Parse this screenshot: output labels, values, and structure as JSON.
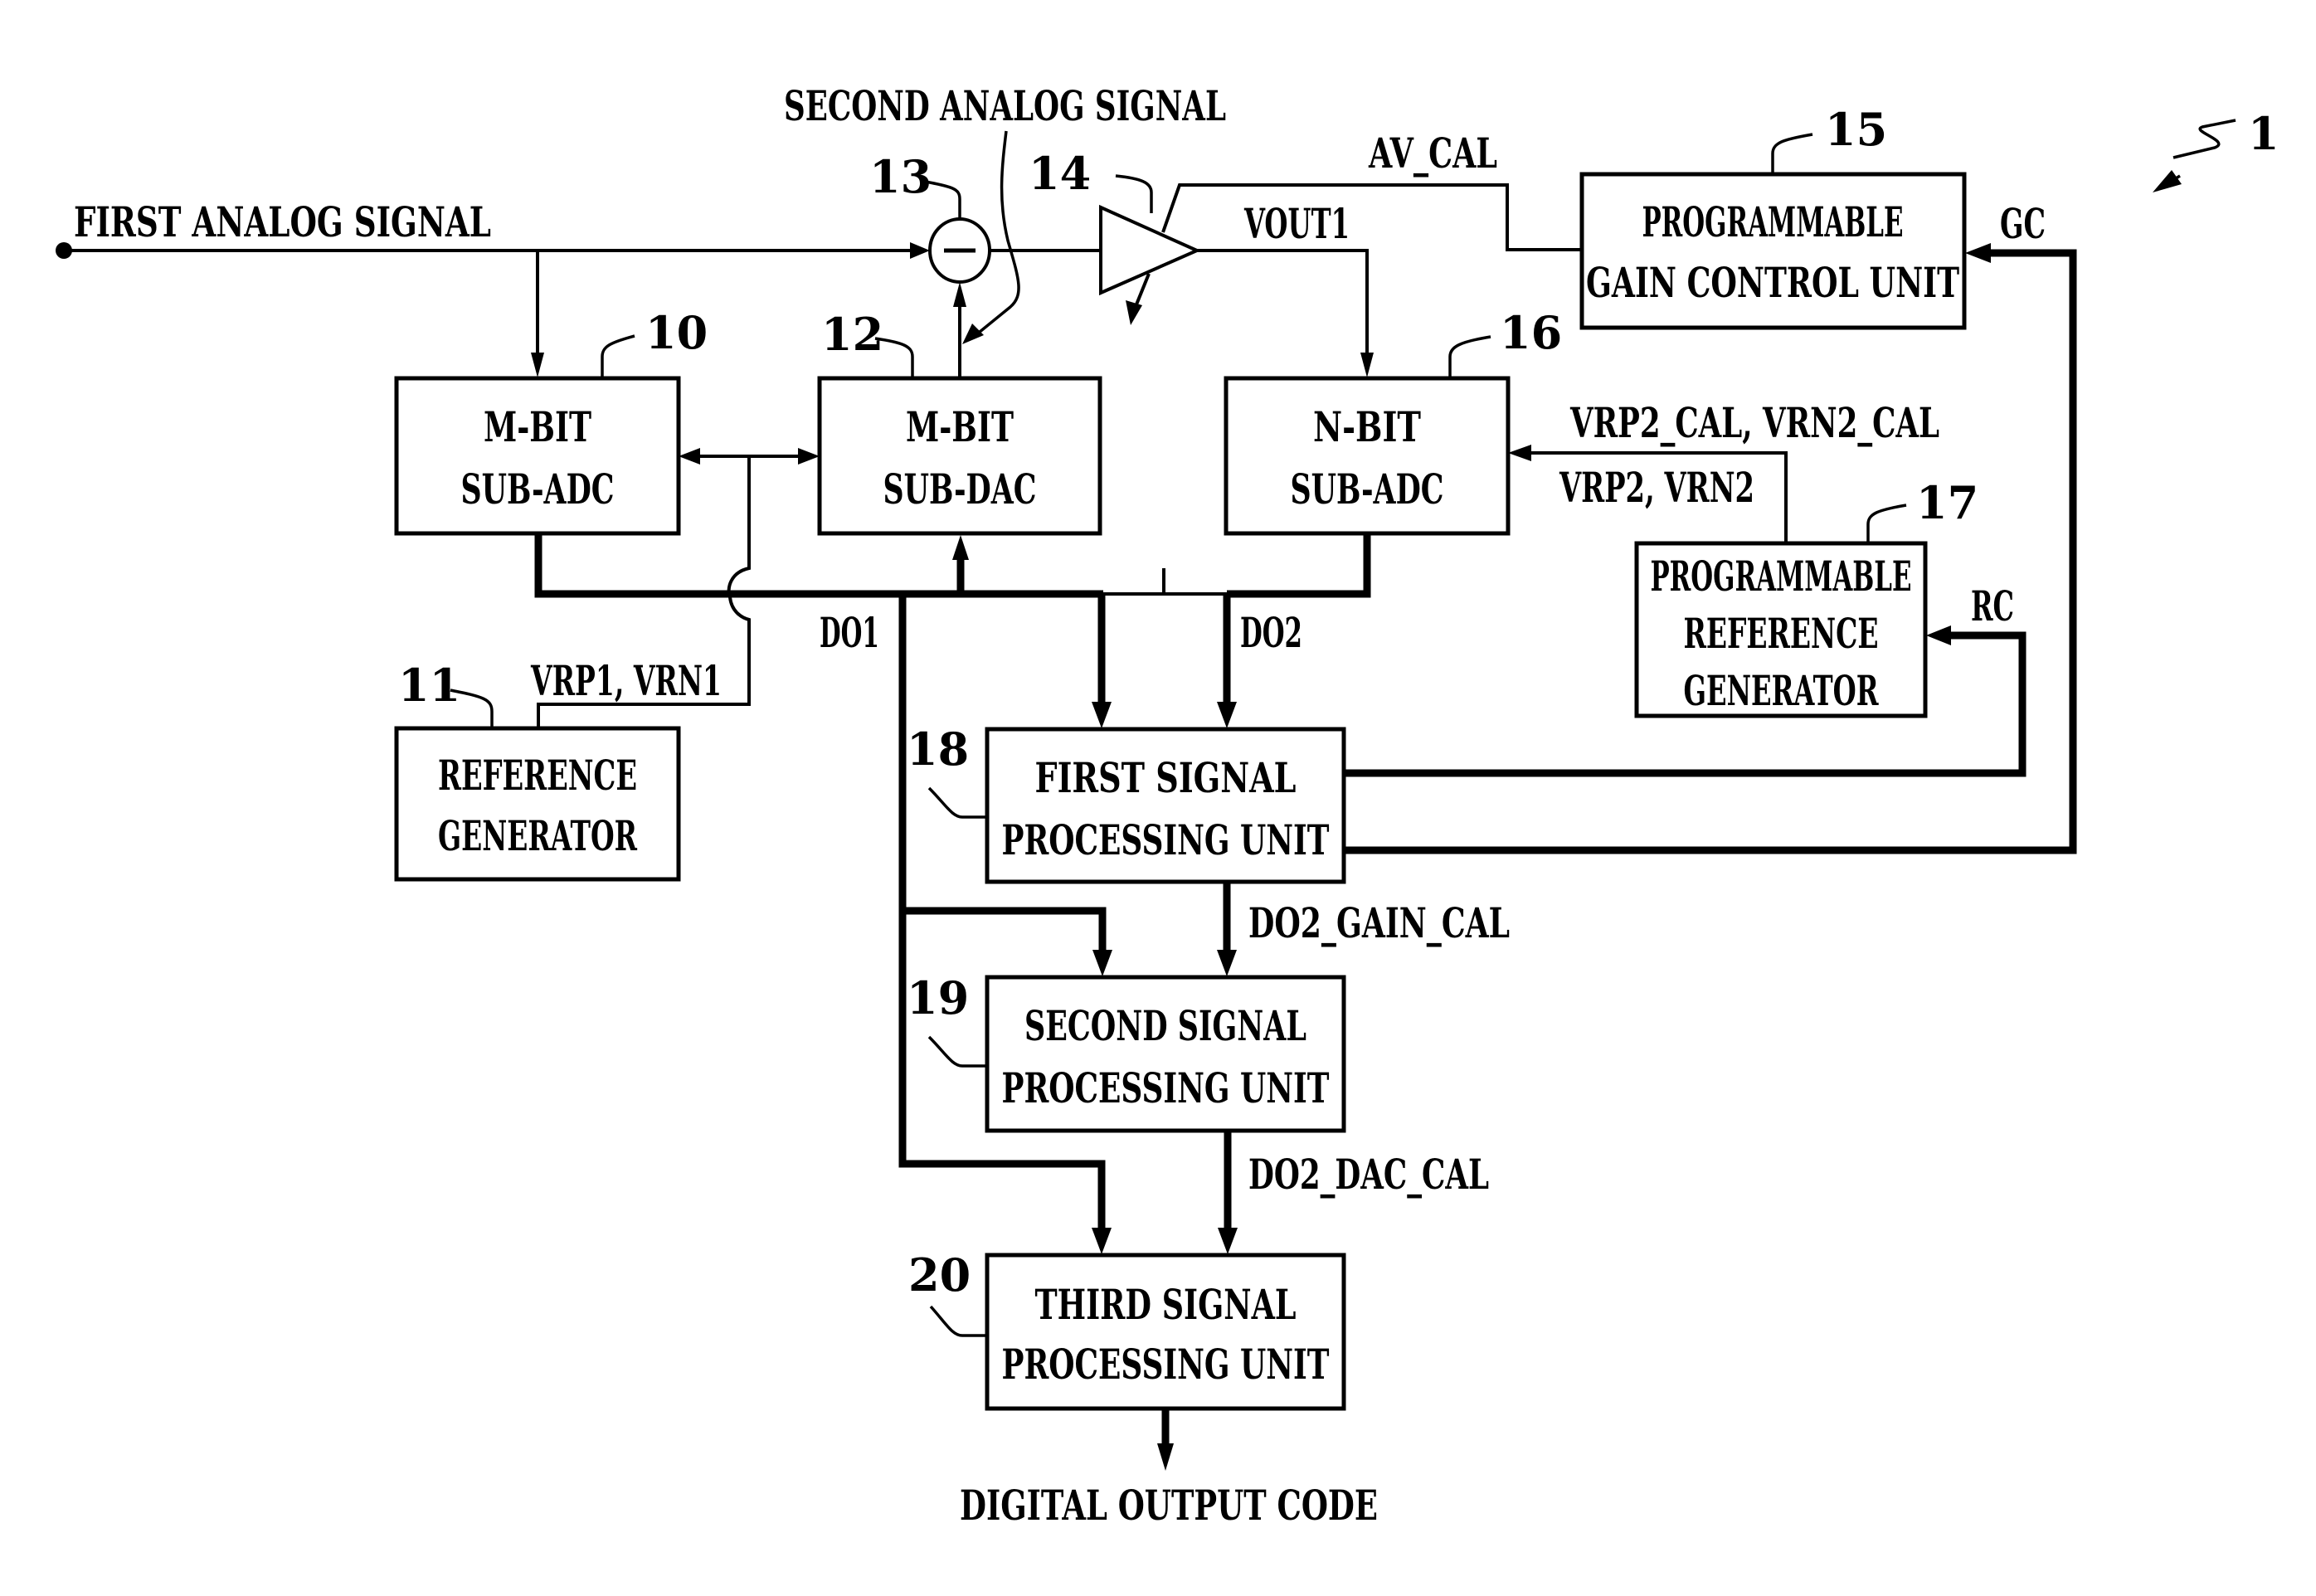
{
  "figure": {
    "system_ref": "1",
    "blocks": {
      "m_bit_sub_adc": {
        "ref": "10",
        "line1": "M-BIT",
        "line2": "SUB-ADC"
      },
      "reference_generator": {
        "ref": "11",
        "line1": "REFERENCE",
        "line2": "GENERATOR"
      },
      "m_bit_sub_dac": {
        "ref": "12",
        "line1": "M-BIT",
        "line2": "SUB-DAC"
      },
      "subtractor": {
        "ref": "13",
        "symbol": "−"
      },
      "amplifier": {
        "ref": "14"
      },
      "programmable_gain_control_unit": {
        "ref": "15",
        "line1": "PROGRAMMABLE",
        "line2": "GAIN CONTROL UNIT"
      },
      "n_bit_sub_adc": {
        "ref": "16",
        "line1": "N-BIT",
        "line2": "SUB-ADC"
      },
      "programmable_reference_generator": {
        "ref": "17",
        "line1": "PROGRAMMABLE",
        "line2": "REFERENCE",
        "line3": "GENERATOR"
      },
      "first_signal_processing_unit": {
        "ref": "18",
        "line1": "FIRST SIGNAL",
        "line2": "PROCESSING UNIT"
      },
      "second_signal_processing_unit": {
        "ref": "19",
        "line1": "SECOND SIGNAL",
        "line2": "PROCESSING UNIT"
      },
      "third_signal_processing_unit": {
        "ref": "20",
        "line1": "THIRD SIGNAL",
        "line2": "PROCESSING UNIT"
      }
    },
    "signals": {
      "first_analog_signal": "FIRST ANALOG SIGNAL",
      "second_analog_signal": "SECOND ANALOG SIGNAL",
      "av_cal": "AV_CAL",
      "vout1": "VOUT1",
      "gc": "GC",
      "rc": "RC",
      "vrp2_cal_vrn2_cal": "VRP2_CAL, VRN2_CAL",
      "vrp2_vrn2": "VRP2, VRN2",
      "vrp1_vrn1": "VRP1, VRN1",
      "do1": "DO1",
      "do2": "DO2",
      "do2_gain_cal": "DO2_GAIN_CAL",
      "do2_dac_cal": "DO2_DAC_CAL",
      "digital_output_code": "DIGITAL OUTPUT CODE"
    }
  }
}
